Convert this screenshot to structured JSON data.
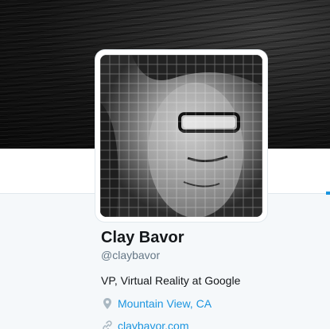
{
  "profile": {
    "name": "Clay Bavor",
    "handle": "@claybavor",
    "bio": "VP, Virtual Reality at Google",
    "location": "Mountain View, CA",
    "website": "claybavor.com"
  },
  "icons": {
    "location": "map-pin-icon",
    "website": "link-icon"
  },
  "colors": {
    "link": "#1b95e0",
    "name": "#14171a",
    "handle": "#657786",
    "background": "#f5f8fa"
  }
}
